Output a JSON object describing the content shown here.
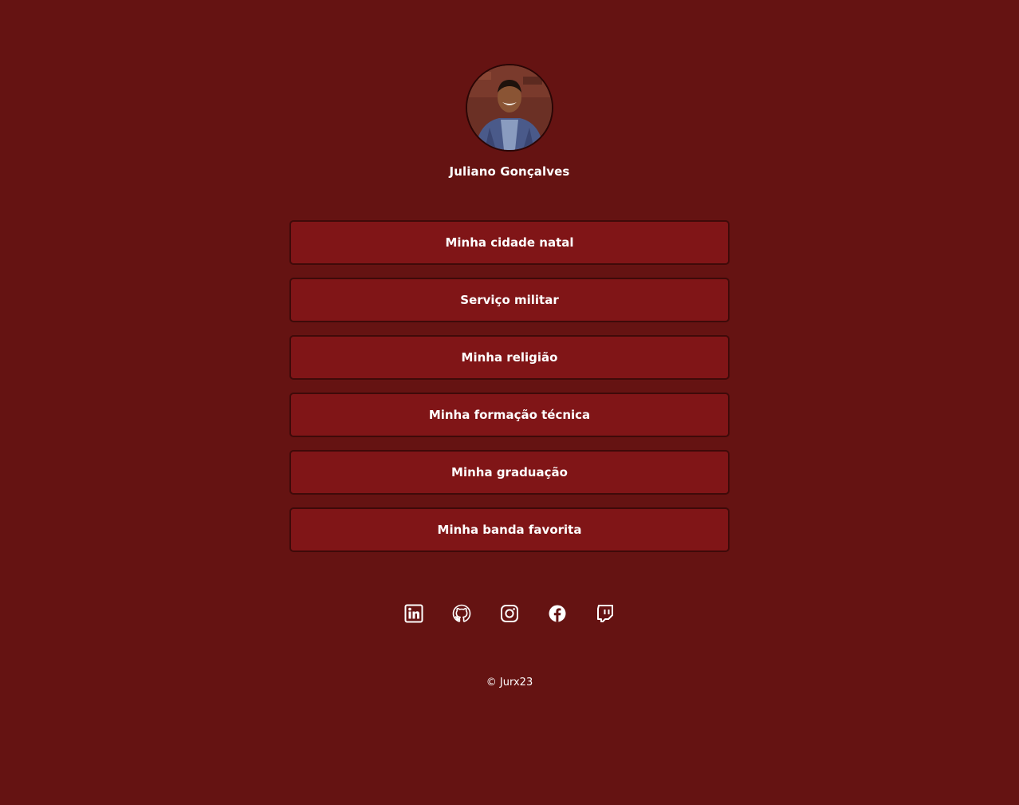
{
  "profile": {
    "name": "Juliano Gonçalves"
  },
  "links": [
    {
      "label": "Minha cidade natal"
    },
    {
      "label": "Serviço militar"
    },
    {
      "label": "Minha religião"
    },
    {
      "label": "Minha formação técnica"
    },
    {
      "label": "Minha graduação"
    },
    {
      "label": "Minha banda favorita"
    }
  ],
  "socials": [
    {
      "icon": "linkedin-icon"
    },
    {
      "icon": "github-icon"
    },
    {
      "icon": "instagram-icon"
    },
    {
      "icon": "facebook-icon"
    },
    {
      "icon": "twitch-icon"
    }
  ],
  "footer": {
    "text": "© Jurx23"
  },
  "colors": {
    "background": "#651312",
    "button": "#801517",
    "button_border": "#3f0a09",
    "text": "#ffffff"
  }
}
